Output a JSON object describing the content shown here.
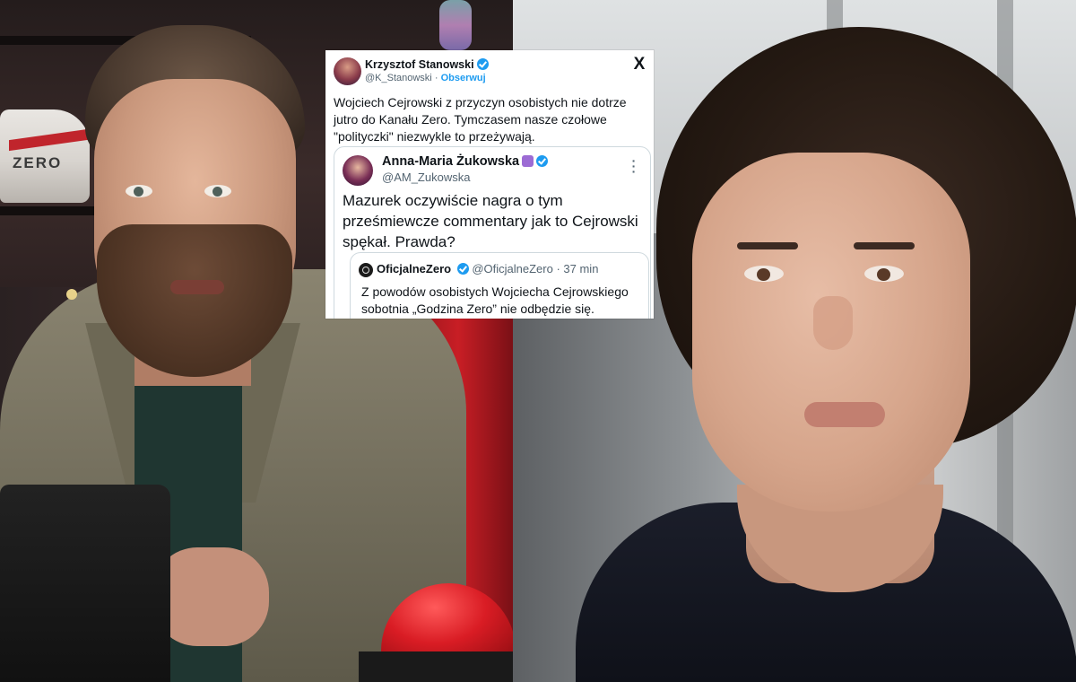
{
  "tweet": {
    "author_name": "Krzysztof Stanowski",
    "author_handle": "@K_Stanowski",
    "separator": "·",
    "follow_label": "Obserwuj",
    "platform_logo": "X",
    "text": "Wojciech Cejrowski z przyczyn osobistych nie dotrze jutro do Kanału Zero. Tymczasem nasze czołowe \"polityczki\" niezwykle to przeżywają.",
    "quoted": {
      "author_name": "Anna-Maria Żukowska",
      "author_handle": "@AM_Zukowska",
      "text": "Mazurek oczywiście nagra o tym prześmiewcze commentary jak to Cejrowski spękał. Prawda?",
      "quoted": {
        "author_name": "OficjalneZero",
        "author_handle": "@OficjalneZero",
        "time": "· 37 min",
        "text": "Z powodów osobistych Wojciecha Cejrowskiego sobotnia „Godzina Zero” nie odbędzie się."
      }
    }
  },
  "photos": {
    "left_shoe_logo": "ZERO"
  },
  "icons": {
    "verified": "verified-badge-icon",
    "x_logo": "x-logo-icon",
    "more": "more-vertical-icon",
    "emoji": "emoji-icon",
    "channel_logo": "channel-logo-icon"
  },
  "colors": {
    "verified_blue": "#1d9bf0",
    "text_primary": "#0f1419",
    "text_secondary": "#536471",
    "border": "#cfd9de"
  }
}
